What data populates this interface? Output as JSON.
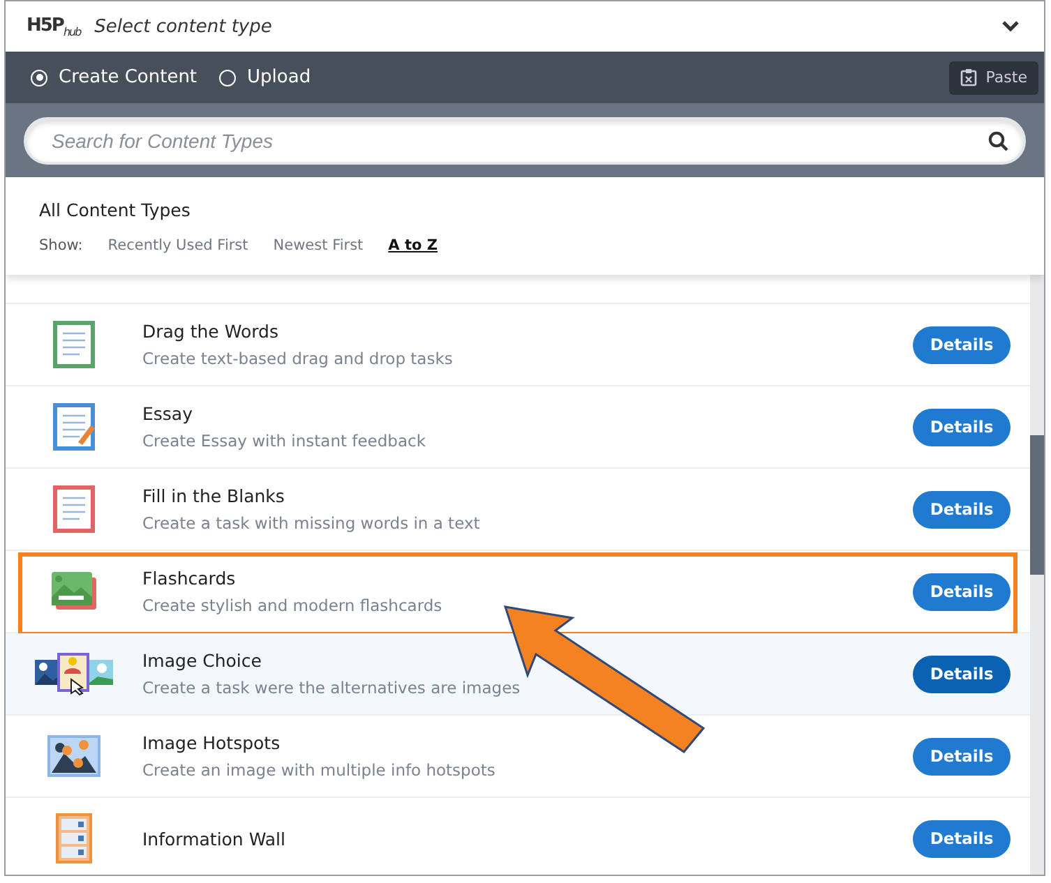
{
  "header": {
    "logo": "H5P",
    "logo_sub": "hub",
    "title": "Select content type"
  },
  "modes": [
    {
      "label": "Create Content",
      "selected": true
    },
    {
      "label": "Upload",
      "selected": false
    }
  ],
  "paste_button": "Paste",
  "search": {
    "placeholder": "Search for Content Types"
  },
  "list_title": "All Content Types",
  "sort": {
    "label": "Show:",
    "options": [
      {
        "label": "Recently Used First",
        "selected": false
      },
      {
        "label": "Newest First",
        "selected": false
      },
      {
        "label": "A to Z",
        "selected": true
      }
    ]
  },
  "items": [
    {
      "kind": "text",
      "title": "Drag the Words",
      "description": "Create text-based drag and drop tasks",
      "button": "Details",
      "hovered": false,
      "highlighted": false
    },
    {
      "kind": "essay",
      "title": "Essay",
      "description": "Create Essay with instant feedback",
      "button": "Details",
      "hovered": false,
      "highlighted": false
    },
    {
      "kind": "blanks",
      "title": "Fill in the Blanks",
      "description": "Create a task with missing words in a text",
      "button": "Details",
      "hovered": false,
      "highlighted": false
    },
    {
      "kind": "cards",
      "title": "Flashcards",
      "description": "Create stylish and modern flashcards",
      "button": "Details",
      "hovered": false,
      "highlighted": true
    },
    {
      "kind": "choice",
      "title": "Image Choice",
      "description": "Create a task were the alternatives are images",
      "button": "Details",
      "hovered": true,
      "highlighted": false
    },
    {
      "kind": "hotspots",
      "title": "Image Hotspots",
      "description": "Create an image with multiple info hotspots",
      "button": "Details",
      "hovered": false,
      "highlighted": false
    },
    {
      "kind": "wall",
      "title": "Information Wall",
      "button": "Details",
      "hovered": false,
      "highlighted": false
    }
  ]
}
